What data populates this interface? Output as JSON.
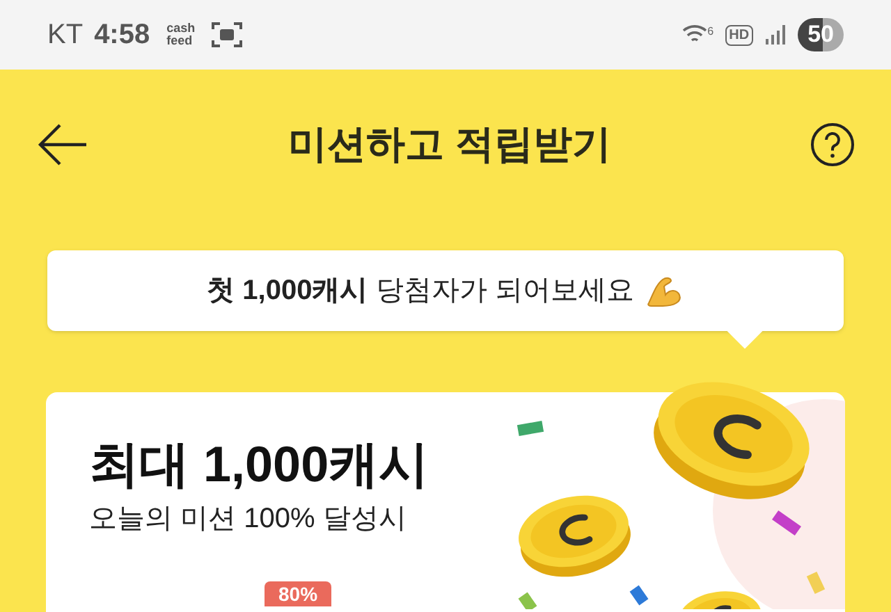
{
  "status_bar": {
    "carrier": "KT",
    "time": "4:58",
    "app_logo": [
      "cash",
      "feed"
    ],
    "network_badge": "HD",
    "wifi_label": "6",
    "battery": "50"
  },
  "header": {
    "title": "미션하고 적립받기"
  },
  "bubble": {
    "text": "**첫 1,000캐시** 당첨자가 되어보세요"
  },
  "reward_card": {
    "title": "최대 1,000캐시",
    "subtitle": "오늘의 미션 100% 달성시",
    "badge": "80%"
  }
}
